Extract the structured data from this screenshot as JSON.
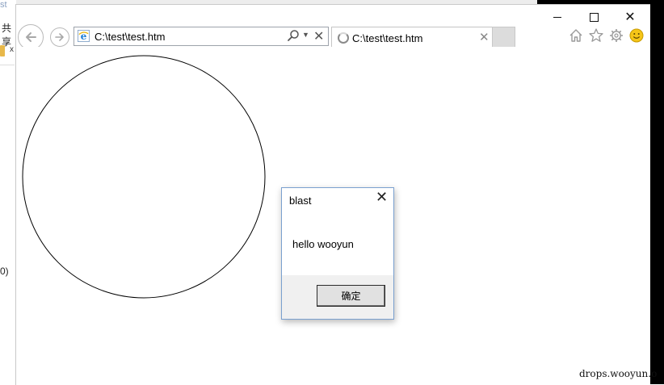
{
  "background_window": {
    "title_fragment": "st",
    "cn_fragment": "共享",
    "close_fragment": "x",
    "paren_fragment": "0)"
  },
  "window_controls": {
    "minimize_icon": "minimize-icon",
    "maximize_icon": "maximize-icon",
    "close_glyph": "✕"
  },
  "navigation": {
    "back_glyph": "←",
    "forward_glyph": "→"
  },
  "address_bar": {
    "url": "C:\\test\\test.htm",
    "icons": [
      "ie-page-icon",
      "search-icon",
      "dropdown-icon",
      "stop-icon"
    ],
    "dropdown_glyph": "▼",
    "stop_glyph": "✕"
  },
  "tabs": [
    {
      "title": "C:\\test\\test.htm",
      "state": "loading",
      "close_glyph": "✕"
    }
  ],
  "toolbar_icons": [
    "home-icon",
    "favorites-star-icon",
    "settings-gear-icon",
    "feedback-smiley-icon"
  ],
  "page": {
    "shape": "circle"
  },
  "dialog": {
    "title": "blast",
    "close_glyph": "✕",
    "message": "hello wooyun",
    "ok_label": "确定"
  },
  "watermark": "drops.wooyun.o",
  "colors": {
    "dialog_border": "#7aa0cf",
    "footer_bg": "#f0f0f0",
    "button_bg": "#e1e1e1",
    "ie_blue": "#1e7fd6",
    "smiley_yellow": "#f5c518"
  }
}
